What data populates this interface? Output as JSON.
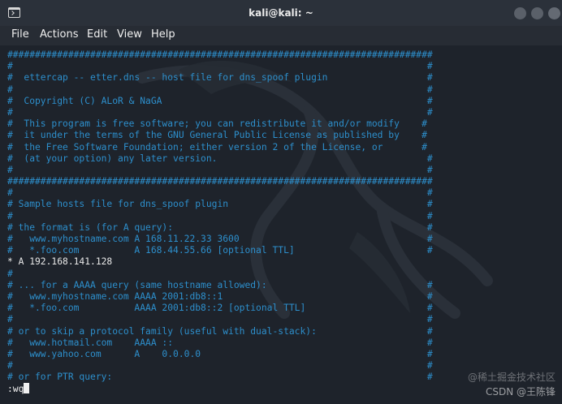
{
  "window": {
    "title": "kali@kali: ~",
    "app_icon": "terminal-icon",
    "controls": [
      "minimize-icon",
      "maximize-icon",
      "close-icon"
    ]
  },
  "menubar": {
    "file": "File",
    "actions": "Actions",
    "edit": "Edit",
    "view": "View",
    "help": "Help"
  },
  "terminal": {
    "lines": [
      "#############################################################################",
      "#                                                                           #",
      "#  ettercap -- etter.dns -- host file for dns_spoof plugin                  #",
      "#                                                                           #",
      "#  Copyright (C) ALoR & NaGA                                                #",
      "#                                                                           #",
      "#  This program is free software; you can redistribute it and/or modify    #",
      "#  it under the terms of the GNU General Public License as published by    #",
      "#  the Free Software Foundation; either version 2 of the License, or       #",
      "#  (at your option) any later version.                                      #",
      "#                                                                           #",
      "#############################################################################",
      "#                                                                           #",
      "# Sample hosts file for dns_spoof plugin                                    #",
      "#                                                                           #",
      "# the format is (for A query):                                              #",
      "#   www.myhostname.com A 168.11.22.33 3600                                  #",
      "#   *.foo.com          A 168.44.55.66 [optional TTL]                        #",
      "* A 192.168.141.128",
      "#",
      "# ... for a AAAA query (same hostname allowed):                             #",
      "#   www.myhostname.com AAAA 2001:db8::1                                     #",
      "#   *.foo.com          AAAA 2001:db8::2 [optional TTL]                      #",
      "#                                                                           #",
      "# or to skip a protocol family (useful with dual-stack):                    #",
      "#   www.hotmail.com    AAAA ::                                              #",
      "#   www.yahoo.com      A    0.0.0.0                                         #",
      "#                                                                           #",
      "# or for PTR query:                                                         #"
    ],
    "plain_line_index": 18,
    "command": ":wq",
    "text_color": "#2d8fcc",
    "plain_color": "#e8e8e8",
    "background": "#1e232b"
  },
  "watermark": {
    "line1": "@稀土掘金技术社区",
    "line2": "CSDN @王陈锋"
  }
}
